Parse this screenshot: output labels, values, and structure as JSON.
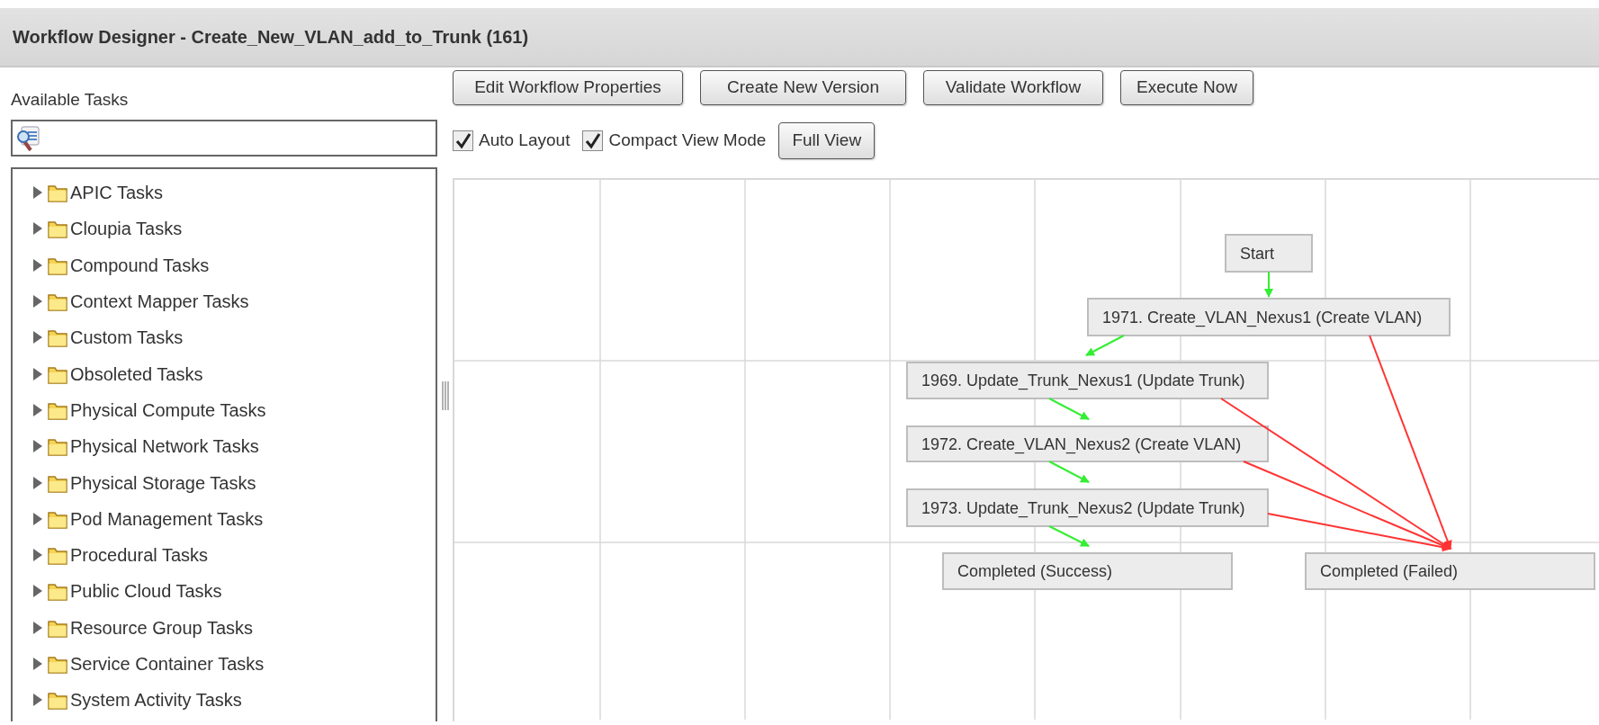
{
  "window": {
    "title": "Workflow Designer - Create_New_VLAN_add_to_Trunk (161)"
  },
  "sidebar": {
    "heading": "Available Tasks",
    "items": [
      {
        "label": "APIC Tasks",
        "expanded": false
      },
      {
        "label": "Cloupia Tasks",
        "expanded": false
      },
      {
        "label": "Compound Tasks",
        "expanded": false
      },
      {
        "label": "Context Mapper Tasks",
        "expanded": false
      },
      {
        "label": "Custom Tasks",
        "expanded": false
      },
      {
        "label": "Obsoleted Tasks",
        "expanded": false
      },
      {
        "label": "Physical Compute Tasks",
        "expanded": false
      },
      {
        "label": "Physical Network Tasks",
        "expanded": false
      },
      {
        "label": "Physical Storage Tasks",
        "expanded": false
      },
      {
        "label": "Pod Management Tasks",
        "expanded": false
      },
      {
        "label": "Procedural Tasks",
        "expanded": false
      },
      {
        "label": "Public Cloud Tasks",
        "expanded": false
      },
      {
        "label": "Resource Group Tasks",
        "expanded": false
      },
      {
        "label": "Service Container Tasks",
        "expanded": false
      },
      {
        "label": "System Activity Tasks",
        "expanded": false
      }
    ]
  },
  "toolbar": {
    "buttons": [
      "Edit Workflow Properties",
      "Create New Version",
      "Validate Workflow",
      "Execute Now"
    ],
    "options": [
      {
        "label": "Auto Layout",
        "checked": true
      },
      {
        "label": "Compact View Mode",
        "checked": true
      }
    ],
    "view_button": "Full View"
  },
  "diagram": {
    "nodes": [
      {
        "label": "Start"
      },
      {
        "label": "1971. Create_VLAN_Nexus1 (Create VLAN)"
      },
      {
        "label": "1969. Update_Trunk_Nexus1 (Update Trunk)"
      },
      {
        "label": "1972. Create_VLAN_Nexus2 (Create VLAN)"
      },
      {
        "label": "1973. Update_Trunk_Nexus2 (Update Trunk)"
      },
      {
        "label": "Completed (Success)"
      },
      {
        "label": "Completed (Failed)"
      }
    ],
    "edges": [
      {
        "kind": "success"
      },
      {
        "kind": "success"
      },
      {
        "kind": "success"
      },
      {
        "kind": "success"
      },
      {
        "kind": "success"
      },
      {
        "kind": "failure"
      },
      {
        "kind": "failure"
      },
      {
        "kind": "failure"
      },
      {
        "kind": "failure"
      }
    ]
  }
}
